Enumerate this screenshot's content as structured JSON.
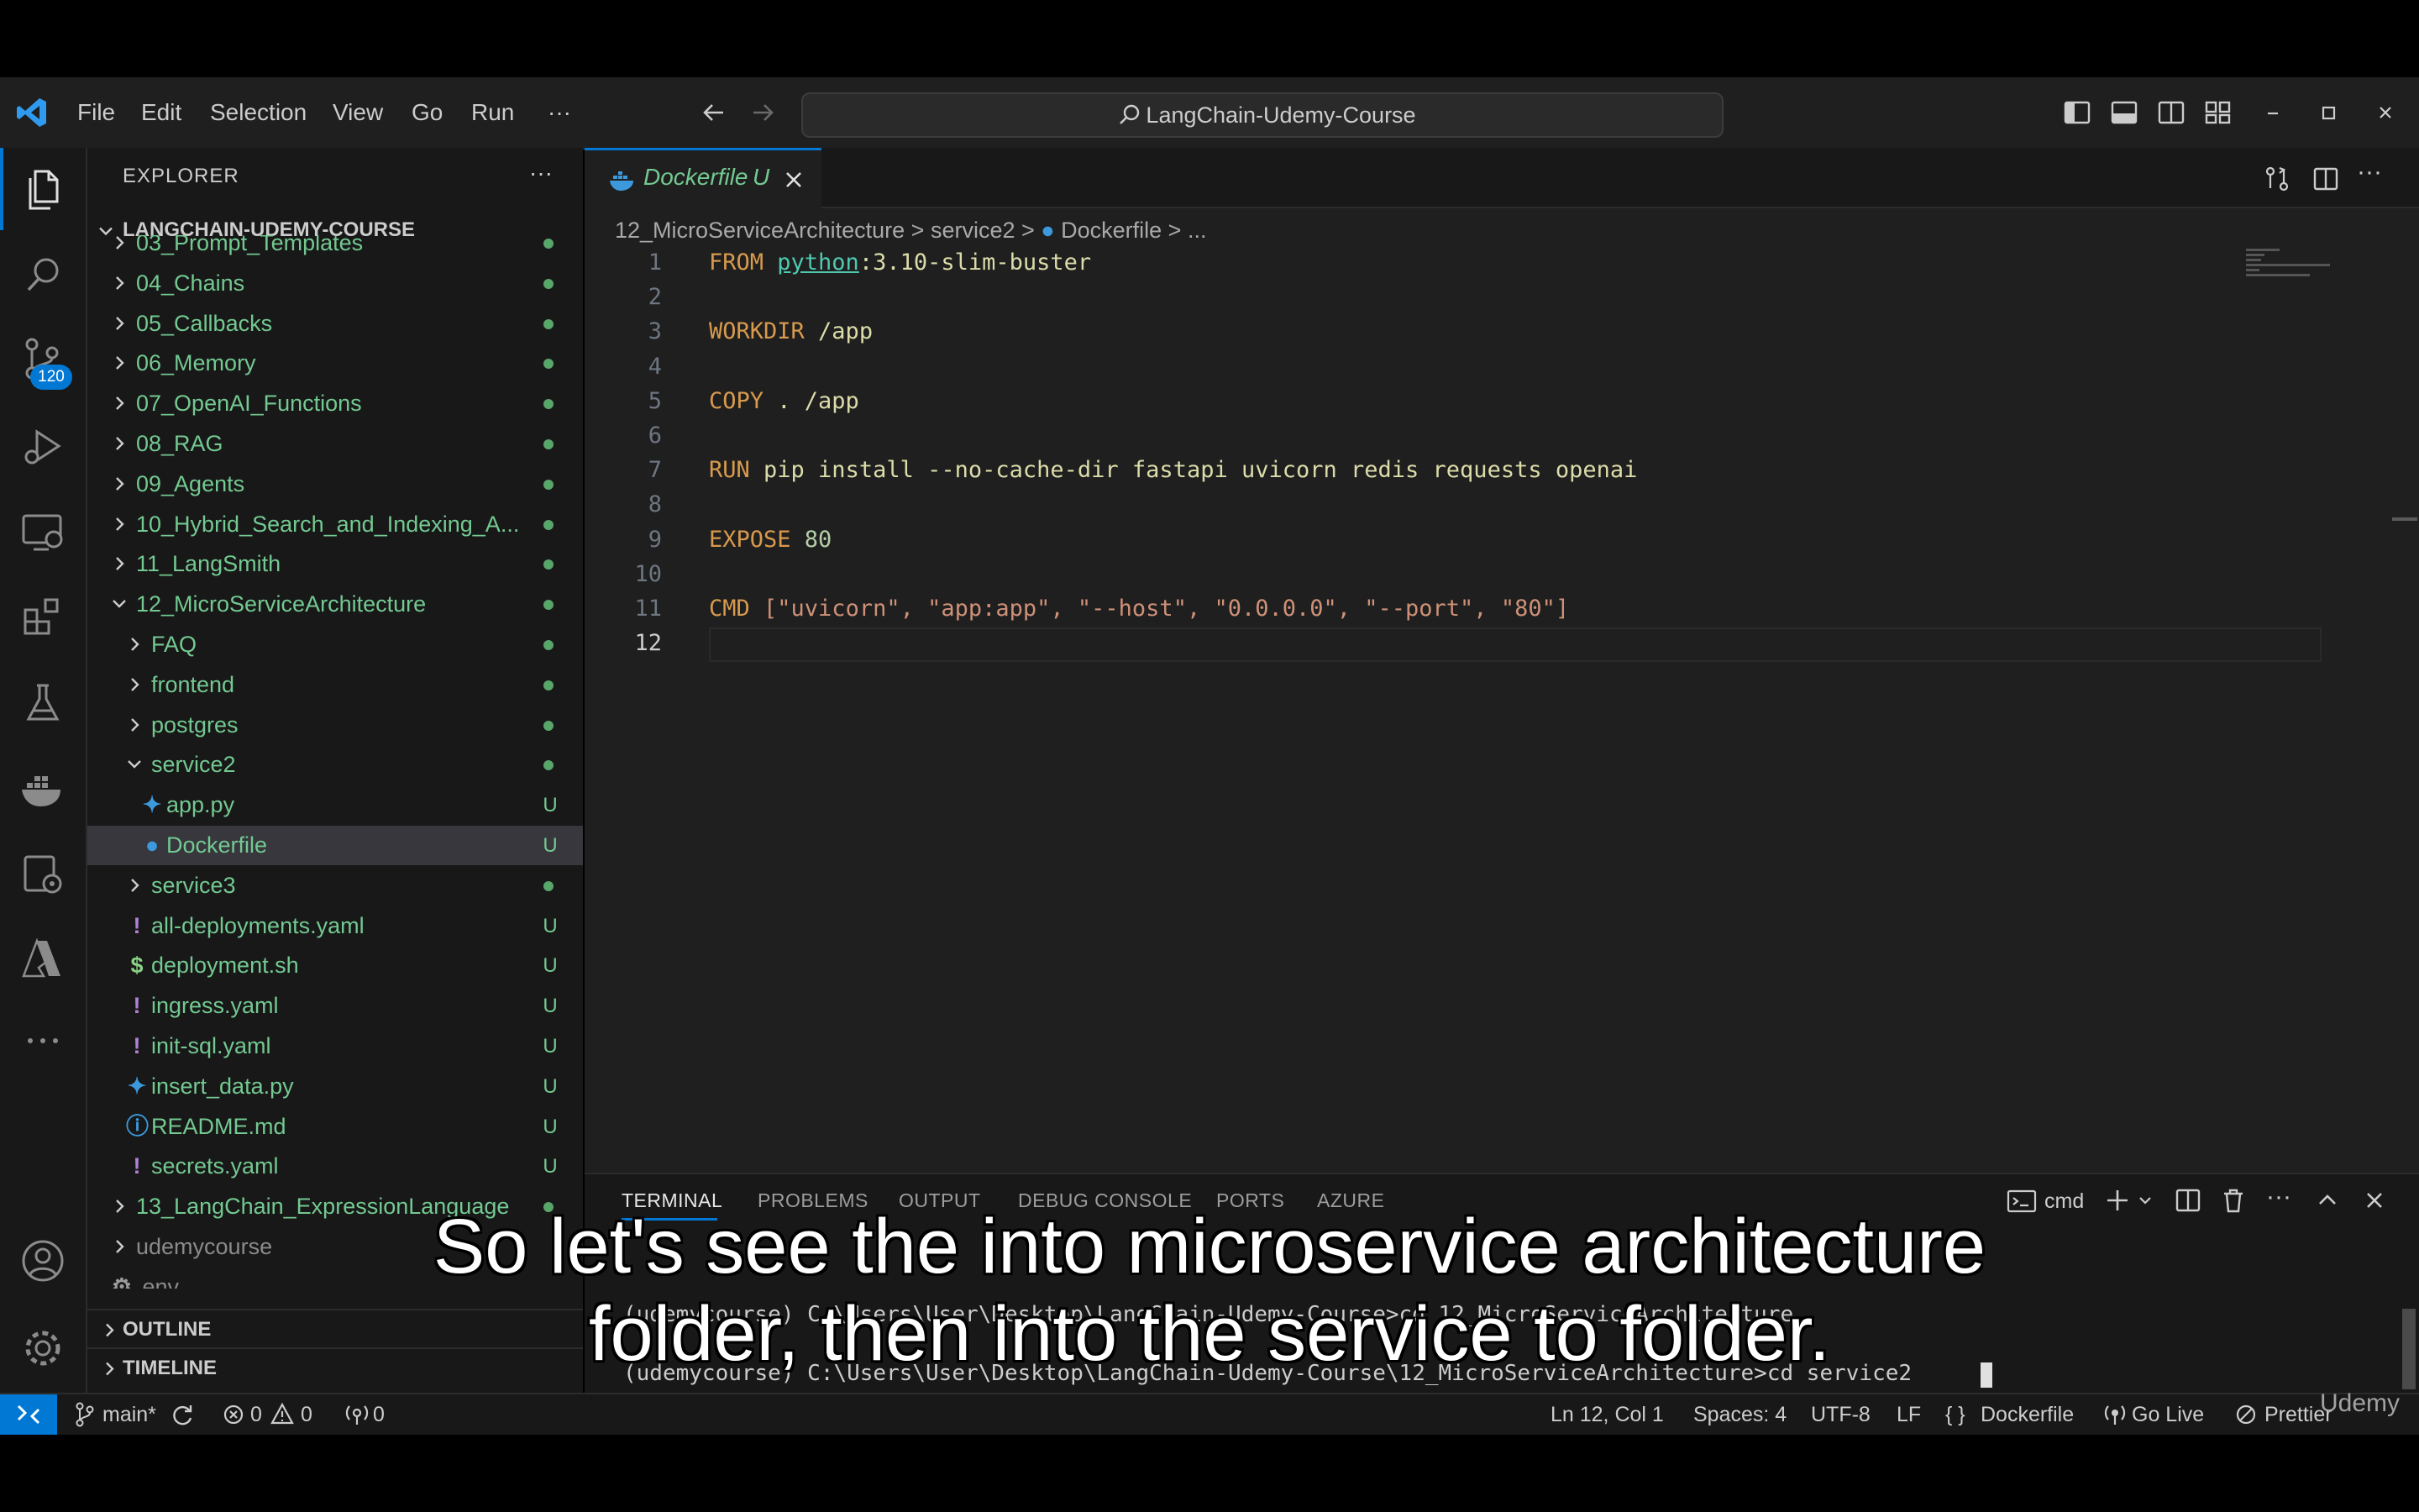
{
  "titlebar": {
    "menu": [
      "File",
      "Edit",
      "Selection",
      "View",
      "Go",
      "Run",
      "···"
    ],
    "search_text": "LangChain-Udemy-Course"
  },
  "activity_bar": {
    "scm_badge": "120"
  },
  "sidebar": {
    "title": "EXPLORER",
    "more": "···",
    "root": "LANGCHAIN-UDEMY-COURSE",
    "rows": [
      {
        "label": "03_Prompt_Templates",
        "mark": "dot",
        "kind": "folder"
      },
      {
        "label": "04_Chains",
        "mark": "dot",
        "kind": "folder"
      },
      {
        "label": "05_Callbacks",
        "mark": "dot",
        "kind": "folder"
      },
      {
        "label": "06_Memory",
        "mark": "dot",
        "kind": "folder"
      },
      {
        "label": "07_OpenAI_Functions",
        "mark": "dot",
        "kind": "folder"
      },
      {
        "label": "08_RAG",
        "mark": "dot",
        "kind": "folder"
      },
      {
        "label": "09_Agents",
        "mark": "dot",
        "kind": "folder"
      },
      {
        "label": "10_Hybrid_Search_and_Indexing_A...",
        "mark": "dot",
        "kind": "folder"
      },
      {
        "label": "11_LangSmith",
        "mark": "dot",
        "kind": "folder"
      },
      {
        "label": "12_MicroServiceArchitecture",
        "mark": "dot",
        "kind": "folder-open"
      },
      {
        "label": "FAQ",
        "mark": "dot",
        "kind": "folder"
      },
      {
        "label": "frontend",
        "mark": "dot",
        "kind": "folder"
      },
      {
        "label": "postgres",
        "mark": "dot",
        "kind": "folder"
      },
      {
        "label": "service2",
        "mark": "dot",
        "kind": "folder-open"
      },
      {
        "label": "app.py",
        "mark": "U",
        "kind": "python"
      },
      {
        "label": "Dockerfile",
        "mark": "U",
        "kind": "docker"
      },
      {
        "label": "service3",
        "mark": "dot",
        "kind": "folder"
      },
      {
        "label": "all-deployments.yaml",
        "mark": "U",
        "kind": "yaml"
      },
      {
        "label": "deployment.sh",
        "mark": "U",
        "kind": "shell"
      },
      {
        "label": "ingress.yaml",
        "mark": "U",
        "kind": "yaml"
      },
      {
        "label": "init-sql.yaml",
        "mark": "U",
        "kind": "yaml"
      },
      {
        "label": "insert_data.py",
        "mark": "U",
        "kind": "python"
      },
      {
        "label": "README.md",
        "mark": "U",
        "kind": "info"
      },
      {
        "label": "secrets.yaml",
        "mark": "U",
        "kind": "yaml"
      },
      {
        "label": "13_LangChain_ExpressionLanguage",
        "mark": "dot",
        "kind": "folder"
      },
      {
        "label": "udemycourse",
        "mark": "",
        "kind": "folder"
      },
      {
        "label": ".env",
        "mark": "",
        "kind": "gear"
      }
    ],
    "outline": "OUTLINE",
    "timeline": "TIMELINE"
  },
  "editor": {
    "tab_label": "Dockerfile",
    "tab_status": "U",
    "breadcrumbs": [
      "12_MicroServiceArchitecture",
      "service2",
      "Dockerfile",
      "..."
    ],
    "lines": [
      {
        "n": "1",
        "tokens": [
          {
            "t": "FROM ",
            "c": "kw"
          },
          {
            "t": "python",
            "c": "img"
          },
          {
            "t": ":3.10-slim-buster",
            "c": "fn"
          }
        ]
      },
      {
        "n": "2",
        "tokens": []
      },
      {
        "n": "3",
        "tokens": [
          {
            "t": "WORKDIR ",
            "c": "kw"
          },
          {
            "t": "/app",
            "c": "fn"
          }
        ]
      },
      {
        "n": "4",
        "tokens": []
      },
      {
        "n": "5",
        "tokens": [
          {
            "t": "COPY ",
            "c": "kw"
          },
          {
            "t": ". /app",
            "c": "fn"
          }
        ]
      },
      {
        "n": "6",
        "tokens": []
      },
      {
        "n": "7",
        "tokens": [
          {
            "t": "RUN ",
            "c": "kw"
          },
          {
            "t": "pip install --no-cache-dir fastapi uvicorn redis requests openai",
            "c": "fn"
          }
        ]
      },
      {
        "n": "8",
        "tokens": []
      },
      {
        "n": "9",
        "tokens": [
          {
            "t": "EXPOSE ",
            "c": "kw"
          },
          {
            "t": "80",
            "c": "num"
          }
        ]
      },
      {
        "n": "10",
        "tokens": []
      },
      {
        "n": "11",
        "tokens": [
          {
            "t": "CMD ",
            "c": "kw"
          },
          {
            "t": "[\"uvicorn\", \"app:app\", \"--host\", \"0.0.0.0\", \"--port\", \"80\"]",
            "c": "str"
          }
        ]
      },
      {
        "n": "12",
        "tokens": []
      }
    ]
  },
  "panel": {
    "tabs": [
      "TERMINAL",
      "PROBLEMS",
      "OUTPUT",
      "DEBUG CONSOLE",
      "PORTS",
      "AZURE"
    ],
    "shell": "cmd",
    "lines": [
      "(udemycourse) C:\\Users\\User\\Desktop\\LangChain-Udemy-Course>cd 12_MicroServiceArchitecture",
      "(udemycourse) C:\\Users\\User\\Desktop\\LangChain-Udemy-Course\\12_MicroServiceArchitecture>cd service2"
    ]
  },
  "statusbar": {
    "branch": "main*",
    "errors": "0",
    "warnings": "0",
    "ports": "0",
    "position": "Ln 12, Col 1",
    "spaces": "Spaces: 4",
    "encoding": "UTF-8",
    "eol": "LF",
    "language": "Dockerfile",
    "golive": "Go Live",
    "prettier": "Prettier"
  },
  "caption": {
    "line1": "So let's see the into microservice architecture",
    "line2": "folder, then into the service to folder."
  },
  "watermark": "Udemy"
}
